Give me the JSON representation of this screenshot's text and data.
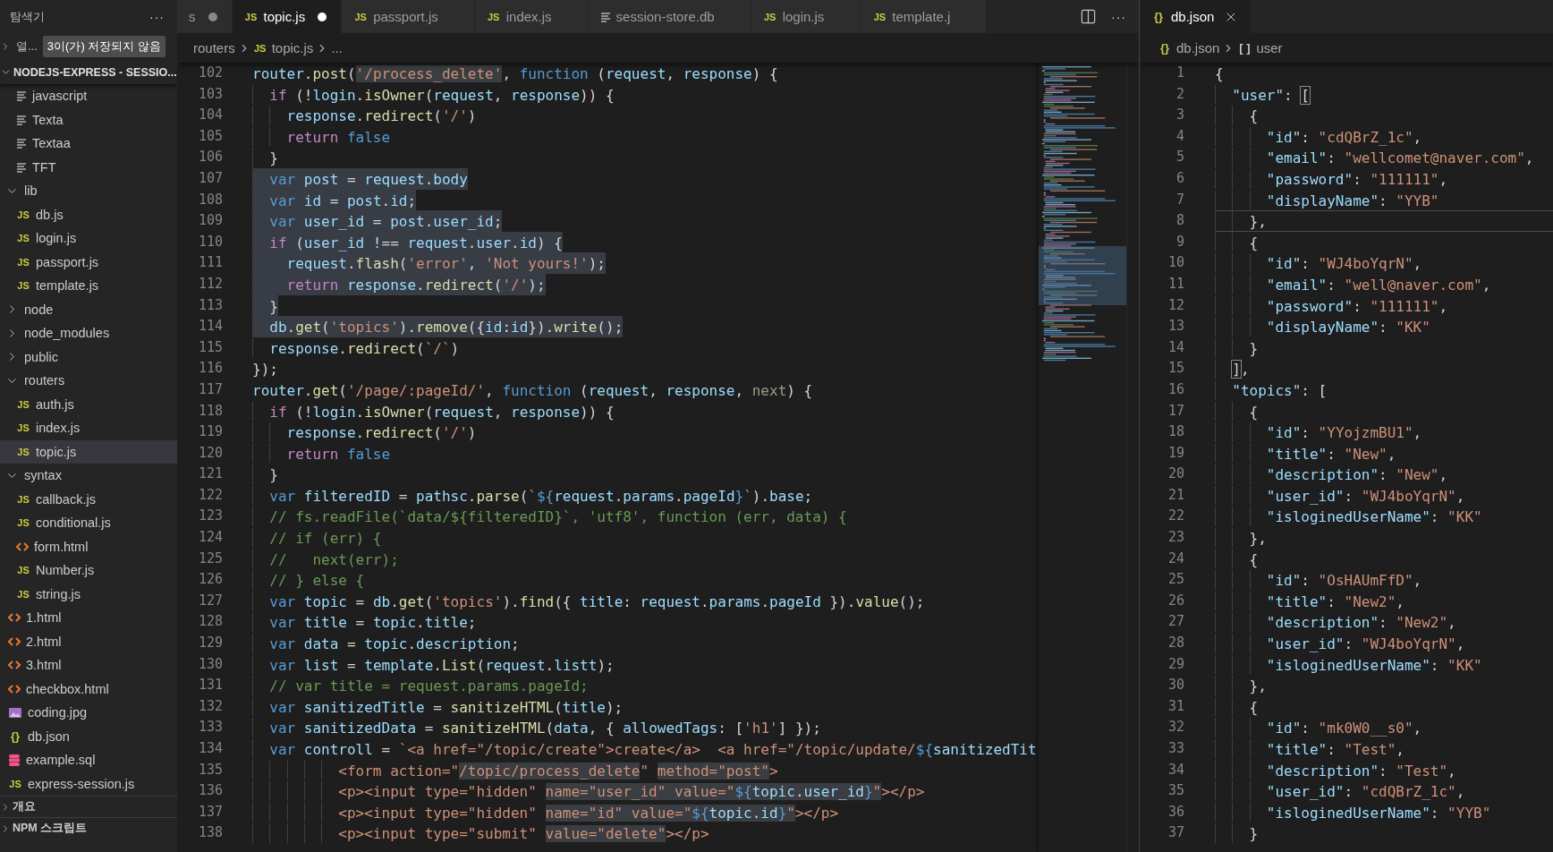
{
  "explorer": {
    "title": "탐색기",
    "more": "···",
    "open_editors": {
      "label": "열...",
      "badge": "3이(가) 저장되지 않음",
      "expanded": false
    },
    "root": {
      "label": "NODEJS-EXPRESS - SESSIO...",
      "expanded": true
    },
    "continued_items": [
      {
        "kind": "text",
        "label": "javascript",
        "selected": false
      },
      {
        "kind": "text",
        "label": "Texta",
        "selected": false
      },
      {
        "kind": "text",
        "label": "Textaa",
        "selected": false
      },
      {
        "kind": "text",
        "label": "TFT",
        "selected": false
      }
    ],
    "tree": [
      {
        "kind": "folder",
        "label": "lib",
        "expanded": true,
        "selected": false,
        "children": [
          {
            "kind": "js",
            "glyph": "JS",
            "label": "db.js",
            "selected": false
          },
          {
            "kind": "js",
            "glyph": "JS",
            "label": "login.js",
            "selected": false
          },
          {
            "kind": "js",
            "glyph": "JS",
            "label": "passport.js",
            "selected": false
          },
          {
            "kind": "js",
            "glyph": "JS",
            "label": "template.js",
            "selected": false
          }
        ]
      },
      {
        "kind": "folder",
        "label": "node",
        "expanded": false,
        "selected": false
      },
      {
        "kind": "folder",
        "label": "node_modules",
        "expanded": false,
        "selected": false
      },
      {
        "kind": "folder",
        "label": "public",
        "expanded": false,
        "selected": false
      },
      {
        "kind": "folder",
        "label": "routers",
        "expanded": true,
        "selected": false,
        "children": [
          {
            "kind": "js",
            "glyph": "JS",
            "label": "auth.js",
            "selected": false
          },
          {
            "kind": "js",
            "glyph": "JS",
            "label": "index.js",
            "selected": false
          },
          {
            "kind": "js",
            "glyph": "JS",
            "label": "topic.js",
            "selected": true
          }
        ]
      },
      {
        "kind": "folder",
        "label": "syntax",
        "expanded": true,
        "selected": false,
        "children": [
          {
            "kind": "js",
            "glyph": "JS",
            "label": "callback.js",
            "selected": false
          },
          {
            "kind": "js",
            "glyph": "JS",
            "label": "conditional.js",
            "selected": false
          },
          {
            "kind": "html",
            "label": "form.html",
            "selected": false
          },
          {
            "kind": "js",
            "glyph": "JS",
            "label": "Number.js",
            "selected": false
          },
          {
            "kind": "js",
            "glyph": "JS",
            "label": "string.js",
            "selected": false
          }
        ]
      },
      {
        "kind": "html",
        "label": "1.html",
        "selected": false
      },
      {
        "kind": "html",
        "label": "2.html",
        "selected": false
      },
      {
        "kind": "html",
        "label": "3.html",
        "selected": false
      },
      {
        "kind": "html",
        "label": "checkbox.html",
        "selected": false
      },
      {
        "kind": "image",
        "label": "coding.jpg",
        "selected": false
      },
      {
        "kind": "json",
        "glyph": "{}",
        "label": "db.json",
        "selected": false
      },
      {
        "kind": "sql",
        "label": "example.sql",
        "selected": false
      },
      {
        "kind": "js",
        "glyph": "JS",
        "label": "express-session.js",
        "selected": false
      }
    ],
    "sections": [
      {
        "label": "개요",
        "expanded": false
      },
      {
        "label": "NPM 스크립트",
        "expanded": false
      }
    ]
  },
  "editor": {
    "more": "···",
    "tabs": [
      {
        "kind": "none",
        "label": "s",
        "modified": true,
        "selected": false
      },
      {
        "kind": "js",
        "glyph": "JS",
        "label": "topic.js",
        "modified": true,
        "selected": true
      },
      {
        "kind": "js",
        "glyph": "JS",
        "label": "passport.js",
        "modified": false,
        "selected": false
      },
      {
        "kind": "js",
        "glyph": "JS",
        "label": "index.js",
        "modified": false,
        "selected": false
      },
      {
        "kind": "text",
        "label": "session-store.db",
        "modified": false,
        "selected": false
      },
      {
        "kind": "js",
        "glyph": "JS",
        "label": "login.js",
        "modified": false,
        "selected": false
      },
      {
        "kind": "js",
        "glyph": "JS",
        "label": "template.j",
        "modified": false,
        "selected": false
      }
    ],
    "breadcrumb": [
      {
        "label": "routers"
      },
      {
        "glyph": "JS",
        "label": "topic.js"
      },
      {
        "label": "..."
      }
    ],
    "lines": [
      {
        "number": "102",
        "selected": false,
        "tokens": [
          {
            "kind": "var",
            "text": "router"
          },
          {
            "kind": "plain",
            "text": "."
          },
          {
            "kind": "func",
            "text": "post"
          },
          {
            "kind": "plain",
            "text": "("
          },
          {
            "kind": "hlstring",
            "text": "'/process_delete'"
          },
          {
            "kind": "plain",
            "text": ", "
          },
          {
            "kind": "storage",
            "text": "function"
          },
          {
            "kind": "plain",
            "text": " ("
          },
          {
            "kind": "var",
            "text": "request"
          },
          {
            "kind": "plain",
            "text": ", "
          },
          {
            "kind": "var",
            "text": "response"
          },
          {
            "kind": "plain",
            "text": ") {"
          }
        ]
      },
      {
        "number": "103",
        "selected": false,
        "tokens": [
          {
            "kind": "control",
            "text": "  if"
          },
          {
            "kind": "plain",
            "text": " (!"
          },
          {
            "kind": "var",
            "text": "login"
          },
          {
            "kind": "plain",
            "text": "."
          },
          {
            "kind": "func",
            "text": "isOwner"
          },
          {
            "kind": "plain",
            "text": "("
          },
          {
            "kind": "var",
            "text": "request"
          },
          {
            "kind": "plain",
            "text": ", "
          },
          {
            "kind": "var",
            "text": "response"
          },
          {
            "kind": "plain",
            "text": ")) {"
          }
        ]
      },
      {
        "number": "104",
        "selected": false,
        "tokens": [
          {
            "kind": "var",
            "text": "    response"
          },
          {
            "kind": "plain",
            "text": "."
          },
          {
            "kind": "func",
            "text": "redirect"
          },
          {
            "kind": "plain",
            "text": "("
          },
          {
            "kind": "string",
            "text": "'/'"
          },
          {
            "kind": "plain",
            "text": ")"
          }
        ]
      },
      {
        "number": "105",
        "selected": false,
        "tokens": [
          {
            "kind": "control",
            "text": "    return"
          },
          {
            "kind": "storage",
            "text": " false"
          }
        ]
      },
      {
        "number": "106",
        "selected": false,
        "tokens": [
          {
            "kind": "plain",
            "text": "  }"
          }
        ]
      },
      {
        "number": "107",
        "selected": true,
        "tokens": [
          {
            "kind": "storage",
            "text": "  var"
          },
          {
            "kind": "var",
            "text": " post"
          },
          {
            "kind": "plain",
            "text": " = "
          },
          {
            "kind": "var",
            "text": "request"
          },
          {
            "kind": "plain",
            "text": "."
          },
          {
            "kind": "var",
            "text": "body"
          }
        ]
      },
      {
        "number": "108",
        "selected": true,
        "tokens": [
          {
            "kind": "storage",
            "text": "  var"
          },
          {
            "kind": "var",
            "text": " id"
          },
          {
            "kind": "plain",
            "text": " = "
          },
          {
            "kind": "var",
            "text": "post"
          },
          {
            "kind": "plain",
            "text": "."
          },
          {
            "kind": "var",
            "text": "id"
          },
          {
            "kind": "plain",
            "text": ";"
          }
        ]
      },
      {
        "number": "109",
        "selected": true,
        "tokens": [
          {
            "kind": "storage",
            "text": "  var"
          },
          {
            "kind": "var",
            "text": " user_id"
          },
          {
            "kind": "plain",
            "text": " = "
          },
          {
            "kind": "var",
            "text": "post"
          },
          {
            "kind": "plain",
            "text": "."
          },
          {
            "kind": "var",
            "text": "user_id"
          },
          {
            "kind": "plain",
            "text": ";"
          }
        ]
      },
      {
        "number": "110",
        "selected": true,
        "tokens": [
          {
            "kind": "control",
            "text": "  if"
          },
          {
            "kind": "plain",
            "text": " ("
          },
          {
            "kind": "var",
            "text": "user_id"
          },
          {
            "kind": "plain",
            "text": " !== "
          },
          {
            "kind": "var",
            "text": "request"
          },
          {
            "kind": "plain",
            "text": "."
          },
          {
            "kind": "var",
            "text": "user"
          },
          {
            "kind": "plain",
            "text": "."
          },
          {
            "kind": "var",
            "text": "id"
          },
          {
            "kind": "plain",
            "text": ") {"
          }
        ]
      },
      {
        "number": "111",
        "selected": true,
        "tokens": [
          {
            "kind": "var",
            "text": "    request"
          },
          {
            "kind": "plain",
            "text": "."
          },
          {
            "kind": "func",
            "text": "flash"
          },
          {
            "kind": "plain",
            "text": "("
          },
          {
            "kind": "string",
            "text": "'error'"
          },
          {
            "kind": "plain",
            "text": ", "
          },
          {
            "kind": "string",
            "text": "'Not yours!'"
          },
          {
            "kind": "plain",
            "text": ");"
          }
        ]
      },
      {
        "number": "112",
        "selected": true,
        "tokens": [
          {
            "kind": "control",
            "text": "    return"
          },
          {
            "kind": "var",
            "text": " response"
          },
          {
            "kind": "plain",
            "text": "."
          },
          {
            "kind": "func",
            "text": "redirect"
          },
          {
            "kind": "plain",
            "text": "("
          },
          {
            "kind": "string",
            "text": "'/'"
          },
          {
            "kind": "plain",
            "text": ");"
          }
        ]
      },
      {
        "number": "113",
        "selected": true,
        "tokens": [
          {
            "kind": "plain",
            "text": "  }"
          }
        ]
      },
      {
        "number": "114",
        "selected": true,
        "tokens": [
          {
            "kind": "var",
            "text": "  db"
          },
          {
            "kind": "plain",
            "text": "."
          },
          {
            "kind": "func",
            "text": "get"
          },
          {
            "kind": "plain",
            "text": "("
          },
          {
            "kind": "string",
            "text": "'topics'"
          },
          {
            "kind": "plain",
            "text": ")."
          },
          {
            "kind": "func",
            "text": "remove"
          },
          {
            "kind": "plain",
            "text": "({"
          },
          {
            "kind": "var",
            "text": "id"
          },
          {
            "kind": "plain",
            "text": ":"
          },
          {
            "kind": "var",
            "text": "id"
          },
          {
            "kind": "plain",
            "text": "})."
          },
          {
            "kind": "func",
            "text": "write"
          },
          {
            "kind": "plain",
            "text": "();"
          }
        ]
      },
      {
        "number": "115",
        "selected": false,
        "tokens": [
          {
            "kind": "var",
            "text": "  response"
          },
          {
            "kind": "plain",
            "text": "."
          },
          {
            "kind": "func",
            "text": "redirect"
          },
          {
            "kind": "plain",
            "text": "("
          },
          {
            "kind": "string",
            "text": "`/`"
          },
          {
            "kind": "plain",
            "text": ")"
          }
        ]
      },
      {
        "number": "116",
        "selected": false,
        "tokens": [
          {
            "kind": "plain",
            "text": "});"
          }
        ]
      },
      {
        "number": "117",
        "selected": false,
        "tokens": [
          {
            "kind": "var",
            "text": "router"
          },
          {
            "kind": "plain",
            "text": "."
          },
          {
            "kind": "func",
            "text": "get"
          },
          {
            "kind": "plain",
            "text": "("
          },
          {
            "kind": "string",
            "text": "'/page/:pageId/'"
          },
          {
            "kind": "plain",
            "text": ", "
          },
          {
            "kind": "storage",
            "text": "function"
          },
          {
            "kind": "plain",
            "text": " ("
          },
          {
            "kind": "var",
            "text": "request"
          },
          {
            "kind": "plain",
            "text": ", "
          },
          {
            "kind": "var",
            "text": "response"
          },
          {
            "kind": "plain",
            "text": ", "
          },
          {
            "kind": "unused",
            "text": "next"
          },
          {
            "kind": "plain",
            "text": ") {"
          }
        ]
      },
      {
        "number": "118",
        "selected": false,
        "tokens": [
          {
            "kind": "control",
            "text": "  if"
          },
          {
            "kind": "plain",
            "text": " (!"
          },
          {
            "kind": "var",
            "text": "login"
          },
          {
            "kind": "plain",
            "text": "."
          },
          {
            "kind": "func",
            "text": "isOwner"
          },
          {
            "kind": "plain",
            "text": "("
          },
          {
            "kind": "var",
            "text": "request"
          },
          {
            "kind": "plain",
            "text": ", "
          },
          {
            "kind": "var",
            "text": "response"
          },
          {
            "kind": "plain",
            "text": ")) {"
          }
        ]
      },
      {
        "number": "119",
        "selected": false,
        "tokens": [
          {
            "kind": "var",
            "text": "    response"
          },
          {
            "kind": "plain",
            "text": "."
          },
          {
            "kind": "func",
            "text": "redirect"
          },
          {
            "kind": "plain",
            "text": "("
          },
          {
            "kind": "string",
            "text": "'/'"
          },
          {
            "kind": "plain",
            "text": ")"
          }
        ]
      },
      {
        "number": "120",
        "selected": false,
        "tokens": [
          {
            "kind": "control",
            "text": "    return"
          },
          {
            "kind": "storage",
            "text": " false"
          }
        ]
      },
      {
        "number": "121",
        "selected": false,
        "tokens": [
          {
            "kind": "plain",
            "text": "  }"
          }
        ]
      },
      {
        "number": "122",
        "selected": false,
        "tokens": [
          {
            "kind": "storage",
            "text": "  var"
          },
          {
            "kind": "var",
            "text": " filteredID"
          },
          {
            "kind": "plain",
            "text": " = "
          },
          {
            "kind": "var",
            "text": "pathsc"
          },
          {
            "kind": "plain",
            "text": "."
          },
          {
            "kind": "func",
            "text": "parse"
          },
          {
            "kind": "plain",
            "text": "("
          },
          {
            "kind": "string",
            "text": "`"
          },
          {
            "kind": "storage",
            "text": "${"
          },
          {
            "kind": "var",
            "text": "request"
          },
          {
            "kind": "plain",
            "text": "."
          },
          {
            "kind": "var",
            "text": "params"
          },
          {
            "kind": "plain",
            "text": "."
          },
          {
            "kind": "var",
            "text": "pageId"
          },
          {
            "kind": "storage",
            "text": "}"
          },
          {
            "kind": "string",
            "text": "`"
          },
          {
            "kind": "plain",
            "text": ")."
          },
          {
            "kind": "var",
            "text": "base"
          },
          {
            "kind": "plain",
            "text": ";"
          }
        ]
      },
      {
        "number": "123",
        "selected": false,
        "tokens": [
          {
            "kind": "comment",
            "text": "  // fs.readFile(`data/${filteredID}`, 'utf8', function (err, data) {"
          }
        ]
      },
      {
        "number": "124",
        "selected": false,
        "tokens": [
          {
            "kind": "comment",
            "text": "  // if (err) {"
          }
        ]
      },
      {
        "number": "125",
        "selected": false,
        "tokens": [
          {
            "kind": "comment",
            "text": "  //   next(err);"
          }
        ]
      },
      {
        "number": "126",
        "selected": false,
        "tokens": [
          {
            "kind": "comment",
            "text": "  // } else {"
          }
        ]
      },
      {
        "number": "127",
        "selected": false,
        "tokens": [
          {
            "kind": "storage",
            "text": "  var"
          },
          {
            "kind": "var",
            "text": " topic"
          },
          {
            "kind": "plain",
            "text": " = "
          },
          {
            "kind": "var",
            "text": "db"
          },
          {
            "kind": "plain",
            "text": "."
          },
          {
            "kind": "func",
            "text": "get"
          },
          {
            "kind": "plain",
            "text": "("
          },
          {
            "kind": "string",
            "text": "'topics'"
          },
          {
            "kind": "plain",
            "text": ")."
          },
          {
            "kind": "func",
            "text": "find"
          },
          {
            "kind": "plain",
            "text": "({ "
          },
          {
            "kind": "var",
            "text": "title"
          },
          {
            "kind": "plain",
            "text": ": "
          },
          {
            "kind": "var",
            "text": "request"
          },
          {
            "kind": "plain",
            "text": "."
          },
          {
            "kind": "var",
            "text": "params"
          },
          {
            "kind": "plain",
            "text": "."
          },
          {
            "kind": "var",
            "text": "pageId"
          },
          {
            "kind": "plain",
            "text": " })."
          },
          {
            "kind": "func",
            "text": "value"
          },
          {
            "kind": "plain",
            "text": "();"
          }
        ]
      },
      {
        "number": "128",
        "selected": false,
        "tokens": [
          {
            "kind": "storage",
            "text": "  var"
          },
          {
            "kind": "var",
            "text": " title"
          },
          {
            "kind": "plain",
            "text": " = "
          },
          {
            "kind": "var",
            "text": "topic"
          },
          {
            "kind": "plain",
            "text": "."
          },
          {
            "kind": "var",
            "text": "title"
          },
          {
            "kind": "plain",
            "text": ";"
          }
        ]
      },
      {
        "number": "129",
        "selected": false,
        "tokens": [
          {
            "kind": "storage",
            "text": "  var"
          },
          {
            "kind": "var",
            "text": " data"
          },
          {
            "kind": "plain",
            "text": " = "
          },
          {
            "kind": "var",
            "text": "topic"
          },
          {
            "kind": "plain",
            "text": "."
          },
          {
            "kind": "var",
            "text": "description"
          },
          {
            "kind": "plain",
            "text": ";"
          }
        ]
      },
      {
        "number": "130",
        "selected": false,
        "tokens": [
          {
            "kind": "storage",
            "text": "  var"
          },
          {
            "kind": "var",
            "text": " list"
          },
          {
            "kind": "plain",
            "text": " = "
          },
          {
            "kind": "var",
            "text": "template"
          },
          {
            "kind": "plain",
            "text": "."
          },
          {
            "kind": "func",
            "text": "List"
          },
          {
            "kind": "plain",
            "text": "("
          },
          {
            "kind": "var",
            "text": "request"
          },
          {
            "kind": "plain",
            "text": "."
          },
          {
            "kind": "var",
            "text": "listt"
          },
          {
            "kind": "plain",
            "text": ");"
          }
        ]
      },
      {
        "number": "131",
        "selected": false,
        "tokens": [
          {
            "kind": "comment",
            "text": "  // var title = request.params.pageId;"
          }
        ]
      },
      {
        "number": "132",
        "selected": false,
        "tokens": [
          {
            "kind": "storage",
            "text": "  var"
          },
          {
            "kind": "var",
            "text": " sanitizedTitle"
          },
          {
            "kind": "plain",
            "text": " = "
          },
          {
            "kind": "func",
            "text": "sanitizeHTML"
          },
          {
            "kind": "plain",
            "text": "("
          },
          {
            "kind": "var",
            "text": "title"
          },
          {
            "kind": "plain",
            "text": ");"
          }
        ]
      },
      {
        "number": "133",
        "selected": false,
        "tokens": [
          {
            "kind": "storage",
            "text": "  var"
          },
          {
            "kind": "var",
            "text": " sanitizedData"
          },
          {
            "kind": "plain",
            "text": " = "
          },
          {
            "kind": "func",
            "text": "sanitizeHTML"
          },
          {
            "kind": "plain",
            "text": "("
          },
          {
            "kind": "var",
            "text": "data"
          },
          {
            "kind": "plain",
            "text": ", { "
          },
          {
            "kind": "var",
            "text": "allowedTags"
          },
          {
            "kind": "plain",
            "text": ": ["
          },
          {
            "kind": "string",
            "text": "'h1'"
          },
          {
            "kind": "plain",
            "text": "] });"
          }
        ]
      },
      {
        "number": "134",
        "selected": false,
        "tokens": [
          {
            "kind": "storage",
            "text": "  var"
          },
          {
            "kind": "var",
            "text": " controll"
          },
          {
            "kind": "plain",
            "text": " = "
          },
          {
            "kind": "string",
            "text": "`<a href=\"/topic/create\">create</a>  <a href=\"/topic/update/"
          },
          {
            "kind": "storage",
            "text": "${"
          },
          {
            "kind": "var",
            "text": "sanitizedTit"
          }
        ]
      },
      {
        "number": "135",
        "selected": false,
        "tokens": [
          {
            "kind": "string",
            "text": "          <form action=\""
          },
          {
            "kind": "hlstring",
            "text": "/topic/process_delete"
          },
          {
            "kind": "string",
            "text": "\" "
          },
          {
            "kind": "hlstring",
            "text": "method=\"post\""
          },
          {
            "kind": "string",
            "text": ">"
          }
        ]
      },
      {
        "number": "136",
        "selected": false,
        "tokens": [
          {
            "kind": "string",
            "text": "          <p><input type=\"hidden\" "
          },
          {
            "kind": "hlstring",
            "text": "name=\"user_id\" "
          },
          {
            "kind": "hlstring",
            "text": "value=\""
          },
          {
            "kind": "hlstorage",
            "text": "${"
          },
          {
            "kind": "hlvar",
            "text": "topic"
          },
          {
            "kind": "hlplain",
            "text": "."
          },
          {
            "kind": "hlvar",
            "text": "user_id"
          },
          {
            "kind": "hlstorage",
            "text": "}"
          },
          {
            "kind": "hlstring",
            "text": "\""
          },
          {
            "kind": "string",
            "text": "></p>"
          }
        ]
      },
      {
        "number": "137",
        "selected": false,
        "tokens": [
          {
            "kind": "string",
            "text": "          <p><input type=\"hidden\" "
          },
          {
            "kind": "hlstring",
            "text": "name=\"id\" "
          },
          {
            "kind": "hlstring",
            "text": "value=\""
          },
          {
            "kind": "hlstorage",
            "text": "${"
          },
          {
            "kind": "hlvar",
            "text": "topic"
          },
          {
            "kind": "hlplain",
            "text": "."
          },
          {
            "kind": "hlvar",
            "text": "id"
          },
          {
            "kind": "hlstorage",
            "text": "}"
          },
          {
            "kind": "hlstring",
            "text": "\""
          },
          {
            "kind": "string",
            "text": "></p>"
          }
        ]
      },
      {
        "number": "138",
        "selected": false,
        "tokens": [
          {
            "kind": "string",
            "text": "          <p><input type=\"submit\" "
          },
          {
            "kind": "hlstring",
            "text": "value=\"delete\""
          },
          {
            "kind": "string",
            "text": "></p>"
          }
        ]
      }
    ]
  },
  "json_editor": {
    "tab": {
      "glyph": "{}",
      "label": "db.json",
      "selected": true,
      "modified": false
    },
    "breadcrumb": [
      {
        "glyph": "{}",
        "label": "db.json"
      },
      {
        "glyph": "[ ]",
        "label": "user"
      }
    ],
    "lines": [
      {
        "number": "1",
        "text": "{",
        "current": false,
        "bracket_match": false
      },
      {
        "number": "2",
        "text": "  \"user\": [",
        "current": false,
        "bracket_match": true
      },
      {
        "number": "3",
        "text": "    {",
        "current": false,
        "bracket_match": false
      },
      {
        "number": "4",
        "text": "      \"id\": \"cdQBrZ_1c\",",
        "current": false,
        "bracket_match": false
      },
      {
        "number": "5",
        "text": "      \"email\": \"wellcomet@naver.com\",",
        "current": false,
        "bracket_match": false
      },
      {
        "number": "6",
        "text": "      \"password\": \"111111\",",
        "current": false,
        "bracket_match": false
      },
      {
        "number": "7",
        "text": "      \"displayName\": \"YYB\"",
        "current": false,
        "bracket_match": false
      },
      {
        "number": "8",
        "text": "    },",
        "current": true,
        "bracket_match": false
      },
      {
        "number": "9",
        "text": "    {",
        "current": false,
        "bracket_match": false
      },
      {
        "number": "10",
        "text": "      \"id\": \"WJ4boYqrN\",",
        "current": false,
        "bracket_match": false
      },
      {
        "number": "11",
        "text": "      \"email\": \"well@naver.com\",",
        "current": false,
        "bracket_match": false
      },
      {
        "number": "12",
        "text": "      \"password\": \"111111\",",
        "current": false,
        "bracket_match": false
      },
      {
        "number": "13",
        "text": "      \"displayName\": \"KK\"",
        "current": false,
        "bracket_match": false
      },
      {
        "number": "14",
        "text": "    }",
        "current": false,
        "bracket_match": false
      },
      {
        "number": "15",
        "text": "  ],",
        "current": false,
        "bracket_match": true
      },
      {
        "number": "16",
        "text": "  \"topics\": [",
        "current": false,
        "bracket_match": false
      },
      {
        "number": "17",
        "text": "    {",
        "current": false,
        "bracket_match": false
      },
      {
        "number": "18",
        "text": "      \"id\": \"YYojzmBU1\",",
        "current": false,
        "bracket_match": false
      },
      {
        "number": "19",
        "text": "      \"title\": \"New\",",
        "current": false,
        "bracket_match": false
      },
      {
        "number": "20",
        "text": "      \"description\": \"New\",",
        "current": false,
        "bracket_match": false
      },
      {
        "number": "21",
        "text": "      \"user_id\": \"WJ4boYqrN\",",
        "current": false,
        "bracket_match": false
      },
      {
        "number": "22",
        "text": "      \"isloginedUserName\": \"KK\"",
        "current": false,
        "bracket_match": false
      },
      {
        "number": "23",
        "text": "    },",
        "current": false,
        "bracket_match": false
      },
      {
        "number": "24",
        "text": "    {",
        "current": false,
        "bracket_match": false
      },
      {
        "number": "25",
        "text": "      \"id\": \"OsHAUmFfD\",",
        "current": false,
        "bracket_match": false
      },
      {
        "number": "26",
        "text": "      \"title\": \"New2\",",
        "current": false,
        "bracket_match": false
      },
      {
        "number": "27",
        "text": "      \"description\": \"New2\",",
        "current": false,
        "bracket_match": false
      },
      {
        "number": "28",
        "text": "      \"user_id\": \"WJ4boYqrN\",",
        "current": false,
        "bracket_match": false
      },
      {
        "number": "29",
        "text": "      \"isloginedUserName\": \"KK\"",
        "current": false,
        "bracket_match": false
      },
      {
        "number": "30",
        "text": "    },",
        "current": false,
        "bracket_match": false
      },
      {
        "number": "31",
        "text": "    {",
        "current": false,
        "bracket_match": false
      },
      {
        "number": "32",
        "text": "      \"id\": \"mk0W0__s0\",",
        "current": false,
        "bracket_match": false
      },
      {
        "number": "33",
        "text": "      \"title\": \"Test\",",
        "current": false,
        "bracket_match": false
      },
      {
        "number": "34",
        "text": "      \"description\": \"Test\",",
        "current": false,
        "bracket_match": false
      },
      {
        "number": "35",
        "text": "      \"user_id\": \"cdQBrZ_1c\",",
        "current": false,
        "bracket_match": false
      },
      {
        "number": "36",
        "text": "      \"isloginedUserName\": \"YYB\"",
        "current": false,
        "bracket_match": false
      },
      {
        "number": "37",
        "text": "    }",
        "current": false,
        "bracket_match": false
      }
    ]
  }
}
